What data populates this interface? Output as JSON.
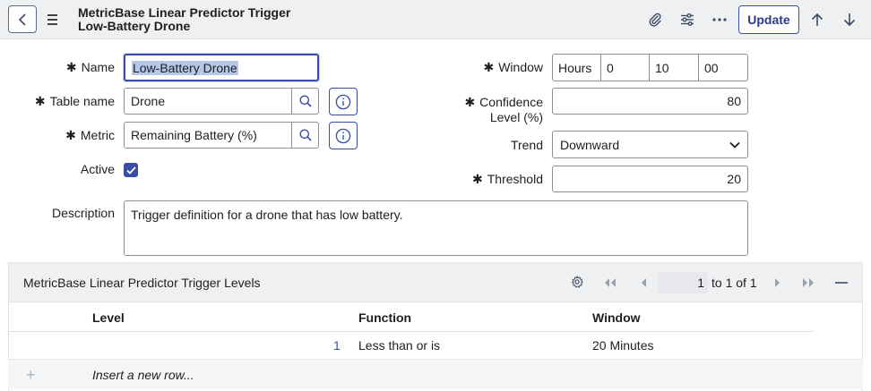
{
  "header": {
    "title_line1": "MetricBase Linear Predictor Trigger",
    "title_line2": "Low-Battery Drone",
    "update_label": "Update"
  },
  "form": {
    "name_label": "Name",
    "name_value": "Low-Battery Drone",
    "table_label": "Table name",
    "table_value": "Drone",
    "metric_label": "Metric",
    "metric_value": "Remaining Battery (%)",
    "active_label": "Active",
    "active_checked": true,
    "window_label": "Window",
    "window_unit": "Hours",
    "window_hours": "0",
    "window_minutes": "10",
    "window_seconds": "00",
    "confidence_label_1": "Confidence",
    "confidence_label_2": "Level (%)",
    "confidence_value": "80",
    "trend_label": "Trend",
    "trend_value": "Downward",
    "threshold_label": "Threshold",
    "threshold_value": "20",
    "description_label": "Description",
    "description_value": "Trigger definition for a drone that has low battery."
  },
  "related_list": {
    "title": "MetricBase Linear Predictor Trigger Levels",
    "page_value": "1",
    "page_range": "to 1 of 1",
    "columns": [
      "Level",
      "Function",
      "Window"
    ],
    "rows": [
      {
        "level": "1",
        "function": "Less than or is",
        "window": "20 Minutes"
      }
    ],
    "insert_label": "Insert a new row..."
  },
  "colors": {
    "accent": "#3b4da8",
    "header_bg": "#eef0f2"
  }
}
